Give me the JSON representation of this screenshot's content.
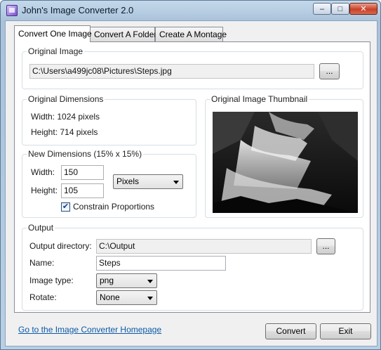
{
  "window": {
    "title": "John's Image Converter 2.0",
    "controls": {
      "minimize": "–",
      "maximize": "□",
      "close": "✕"
    }
  },
  "tabs": [
    {
      "label": "Convert One Image"
    },
    {
      "label": "Convert A Folder"
    },
    {
      "label": "Create A Montage"
    }
  ],
  "original_image": {
    "group_label": "Original Image",
    "path": "C:\\Users\\a499jc08\\Pictures\\Steps.jpg",
    "browse_label": "..."
  },
  "original_dimensions": {
    "group_label": "Original Dimensions",
    "width_text": "Width: 1024 pixels",
    "height_text": "Height: 714 pixels"
  },
  "thumbnail": {
    "group_label": "Original Image Thumbnail"
  },
  "new_dimensions": {
    "group_label": "New Dimensions (15% x 15%)",
    "width_label": "Width:",
    "width_value": "150",
    "height_label": "Height:",
    "height_value": "105",
    "unit_selected": "Pixels",
    "constrain_label": "Constrain Proportions",
    "constrain_checked": "✔"
  },
  "output": {
    "group_label": "Output",
    "directory_label": "Output directory:",
    "directory_value": "C:\\Output",
    "browse_label": "...",
    "name_label": "Name:",
    "name_value": "Steps",
    "type_label": "Image type:",
    "type_selected": "png",
    "rotate_label": "Rotate:",
    "rotate_selected": "None"
  },
  "footer": {
    "homepage_link": "Go to the Image Converter Homepage",
    "convert_label": "Convert",
    "exit_label": "Exit"
  }
}
